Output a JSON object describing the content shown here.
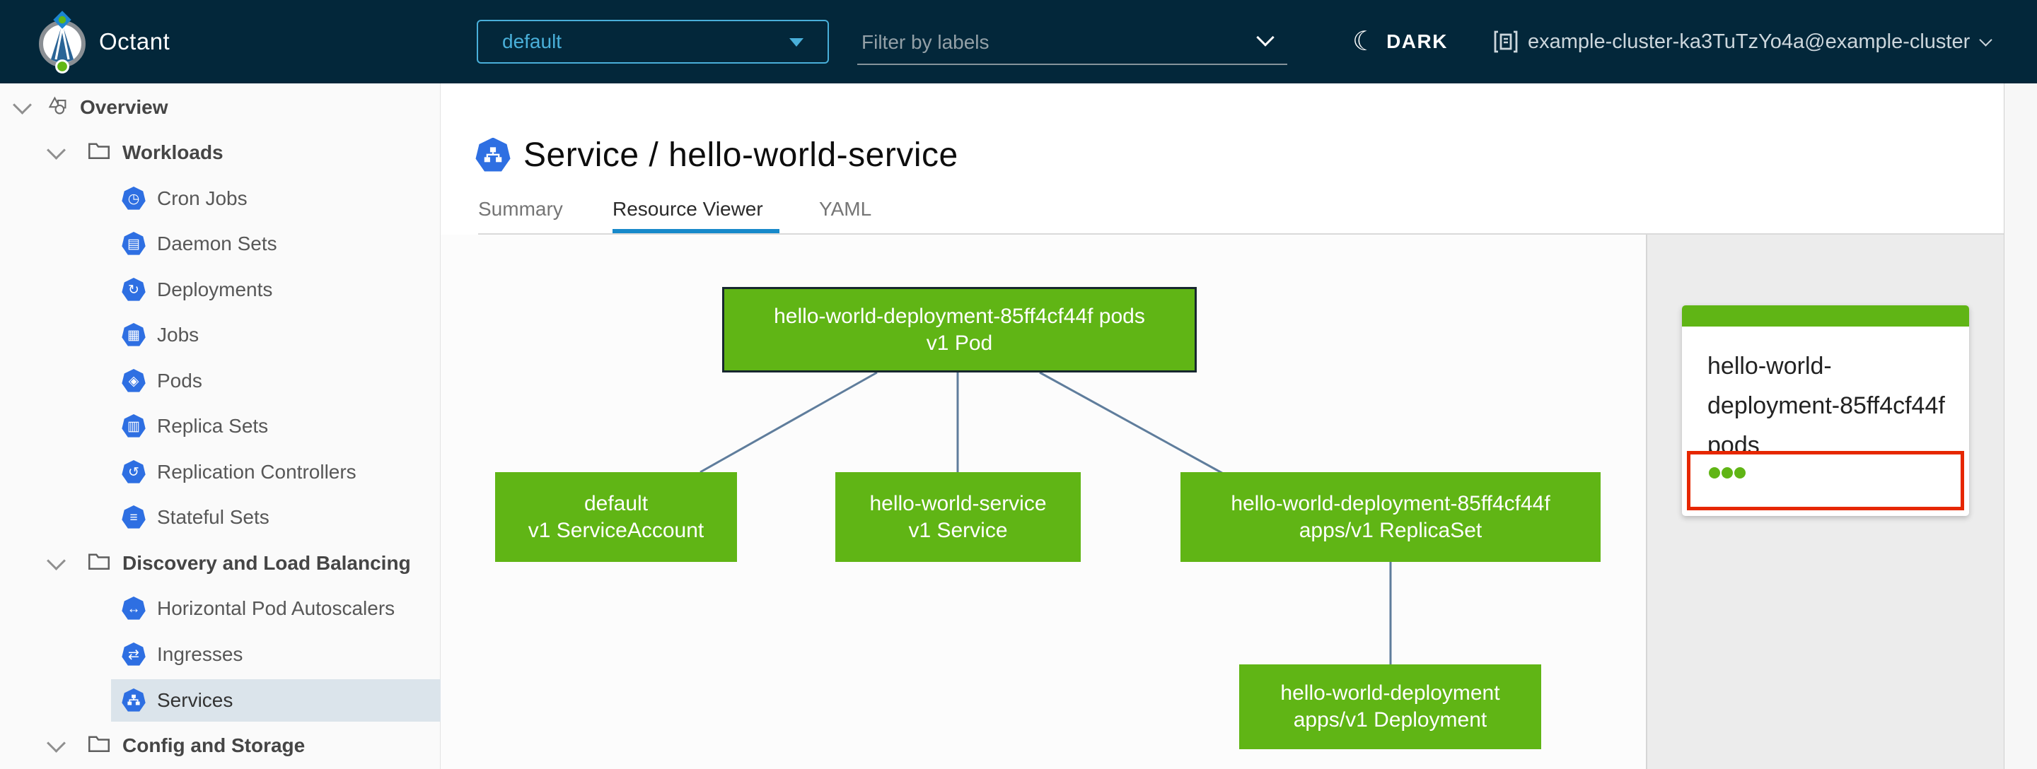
{
  "header": {
    "app_name": "Octant",
    "namespace_dropdown": {
      "value": "default"
    },
    "filter": {
      "placeholder": "Filter by labels"
    },
    "theme_toggle": {
      "label": "DARK"
    },
    "cluster_selector": {
      "value": "example-cluster-ka3TuTzYo4a@example-cluster"
    }
  },
  "sidebar": {
    "items": [
      {
        "label": "Overview",
        "level": "root",
        "expanded": true,
        "selected": false
      },
      {
        "label": "Workloads",
        "level": "group",
        "expanded": true,
        "selected": false
      },
      {
        "label": "Cron Jobs",
        "level": "child",
        "selected": false
      },
      {
        "label": "Daemon Sets",
        "level": "child",
        "selected": false
      },
      {
        "label": "Deployments",
        "level": "child",
        "selected": false
      },
      {
        "label": "Jobs",
        "level": "child",
        "selected": false
      },
      {
        "label": "Pods",
        "level": "child",
        "selected": false
      },
      {
        "label": "Replica Sets",
        "level": "child",
        "selected": false
      },
      {
        "label": "Replication Controllers",
        "level": "child",
        "selected": false
      },
      {
        "label": "Stateful Sets",
        "level": "child",
        "selected": false
      },
      {
        "label": "Discovery and Load Balancing",
        "level": "group",
        "expanded": true,
        "selected": false
      },
      {
        "label": "Horizontal Pod Autoscalers",
        "level": "child",
        "selected": false
      },
      {
        "label": "Ingresses",
        "level": "child",
        "selected": false
      },
      {
        "label": "Services",
        "level": "child",
        "selected": true
      },
      {
        "label": "Config and Storage",
        "level": "group",
        "expanded": true,
        "selected": false
      }
    ]
  },
  "icons": {
    "cron_jobs": "◷",
    "daemon_sets": "▤",
    "deployments": "↻",
    "jobs": "▦",
    "pods": "◈",
    "replica_sets": "▥",
    "replication_controllers": "↺",
    "stateful_sets": "≡",
    "horizontal_pod_autoscalers": "↔",
    "ingresses": "⇄",
    "services": "network-glyph-svg",
    "overview": "objects-outline-svg",
    "group": "folder-outline-svg",
    "theme": "moon-crescent",
    "cluster": "cluster-window-svg"
  },
  "main": {
    "page_title": "Service / hello-world-service",
    "tabs": [
      {
        "label": "Summary",
        "active": false
      },
      {
        "label": "Resource Viewer",
        "active": true
      },
      {
        "label": "YAML",
        "active": false
      }
    ]
  },
  "graph": {
    "nodes": [
      {
        "id": "pod",
        "line1": "hello-world-deployment-85ff4cf44f pods",
        "line2": "v1 Pod",
        "selected": true
      },
      {
        "id": "serviceaccount",
        "line1": "default",
        "line2": "v1 ServiceAccount",
        "selected": false
      },
      {
        "id": "service",
        "line1": "hello-world-service",
        "line2": "v1 Service",
        "selected": false
      },
      {
        "id": "replicaset",
        "line1": "hello-world-deployment-85ff4cf44f",
        "line2": "apps/v1 ReplicaSet",
        "selected": false
      },
      {
        "id": "deployment",
        "line1": "hello-world-deployment",
        "line2": "apps/v1 Deployment",
        "selected": false
      }
    ],
    "edges": [
      {
        "from": "pod",
        "to": "serviceaccount"
      },
      {
        "from": "pod",
        "to": "service"
      },
      {
        "from": "pod",
        "to": "replicaset"
      },
      {
        "from": "replicaset",
        "to": "deployment"
      }
    ]
  },
  "detail_panel": {
    "card": {
      "title": "hello-world-deployment-85ff4cf44f pods",
      "status_dot_count": 3
    }
  },
  "colors": {
    "header_bg": "#03273a",
    "accent_blue": "#49afd9",
    "k8s_icon_blue": "#2e6fe2",
    "node_green": "#60b515",
    "node_selected_border": "#17272f",
    "edge_gray_blue": "#5f7d9c",
    "tab_active_underline": "#1789ca",
    "selection_red": "#e62700",
    "sidebar_selected_bg": "#dbe4eb",
    "panel_bg": "#ececec"
  }
}
